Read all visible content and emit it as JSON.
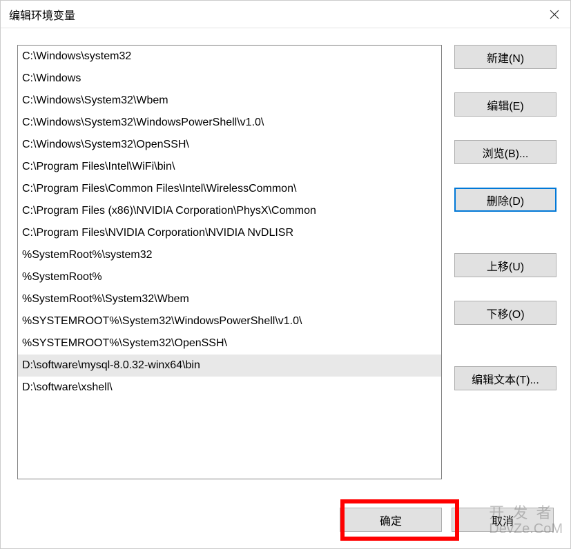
{
  "dialog": {
    "title": "编辑环境变量"
  },
  "paths": [
    "C:\\Windows\\system32",
    "C:\\Windows",
    "C:\\Windows\\System32\\Wbem",
    "C:\\Windows\\System32\\WindowsPowerShell\\v1.0\\",
    "C:\\Windows\\System32\\OpenSSH\\",
    "C:\\Program Files\\Intel\\WiFi\\bin\\",
    "C:\\Program Files\\Common Files\\Intel\\WirelessCommon\\",
    "C:\\Program Files (x86)\\NVIDIA Corporation\\PhysX\\Common",
    "C:\\Program Files\\NVIDIA Corporation\\NVIDIA NvDLISR",
    "%SystemRoot%\\system32",
    "%SystemRoot%",
    "%SystemRoot%\\System32\\Wbem",
    "%SYSTEMROOT%\\System32\\WindowsPowerShell\\v1.0\\",
    "%SYSTEMROOT%\\System32\\OpenSSH\\",
    "D:\\software\\mysql-8.0.32-winx64\\bin",
    "D:\\software\\xshell\\"
  ],
  "selectedIndex": 14,
  "buttons": {
    "new": "新建(N)",
    "edit": "编辑(E)",
    "browse": "浏览(B)...",
    "delete": "删除(D)",
    "moveUp": "上移(U)",
    "moveDown": "下移(O)",
    "editText": "编辑文本(T)...",
    "ok": "确定",
    "cancel": "取消"
  },
  "watermark": {
    "line1": "开 发 者",
    "line2": "DevZe.CoM"
  }
}
